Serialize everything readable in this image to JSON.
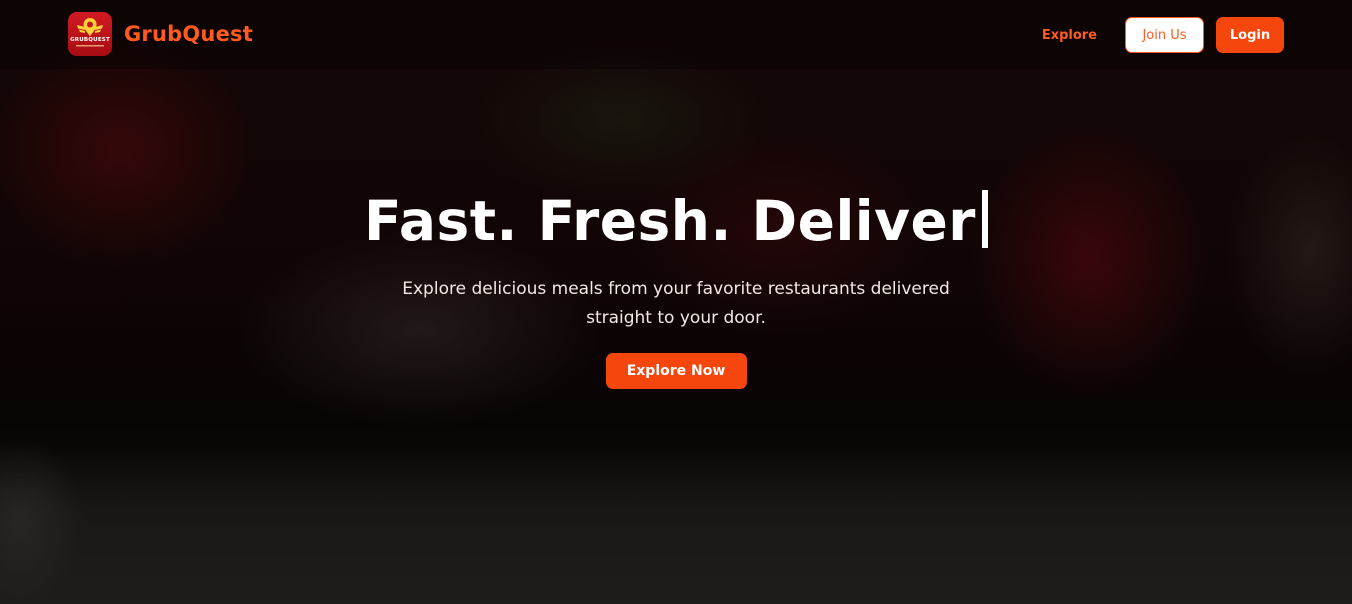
{
  "navbar": {
    "brand_name": "GrubQuest",
    "logo": {
      "text": "GRUBQUEST",
      "icon": "location-pin-wings-icon",
      "background": "#c8141c"
    },
    "links": {
      "explore_label": "Explore",
      "join_label": "Join Us",
      "login_label": "Login"
    }
  },
  "hero": {
    "title": "Fast. Fresh. Deliver",
    "subtitle": "Explore delicious meals from your favorite restaurants delivered straight to your door.",
    "cta_label": "Explore Now"
  },
  "colors": {
    "accent": "#f5470d",
    "brand_text": "#ff5a1f",
    "hero_text": "#ffffff"
  }
}
